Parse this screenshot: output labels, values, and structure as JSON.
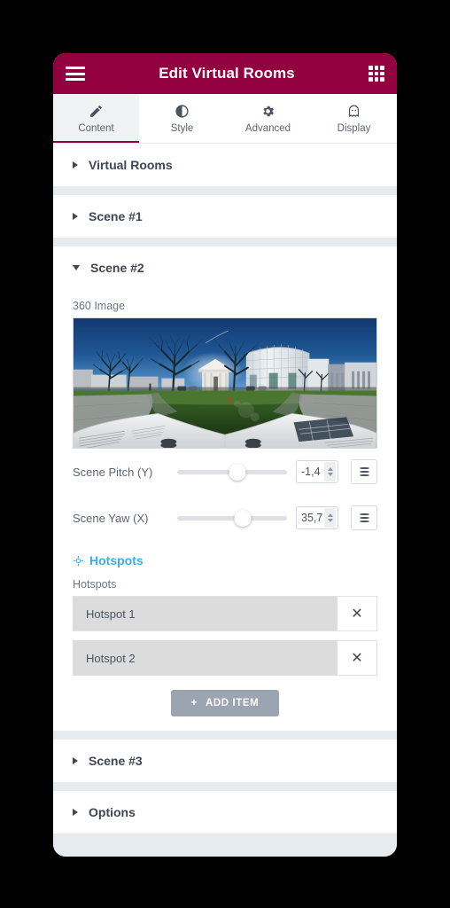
{
  "topbar": {
    "menu_icon": "hamburger-menu-icon",
    "title": "Edit Virtual Rooms",
    "apps_icon": "grid-apps-icon"
  },
  "tabs": [
    {
      "label": "Content",
      "icon": "pencil-icon",
      "active": true
    },
    {
      "label": "Style",
      "icon": "contrast-icon",
      "active": false
    },
    {
      "label": "Advanced",
      "icon": "gear-icon",
      "active": false
    },
    {
      "label": "Display",
      "icon": "ghost-icon",
      "active": false
    }
  ],
  "sections": {
    "virtual_rooms": "Virtual Rooms",
    "scene_1": "Scene #1",
    "scene_2": "Scene #2",
    "scene_3": "Scene #3",
    "options": "Options"
  },
  "scene2": {
    "image_label": "360 Image",
    "sliders": [
      {
        "name": "Scene Pitch (Y)",
        "value": "-1,4",
        "percent": 55
      },
      {
        "name": "Scene Yaw (X)",
        "value": "35,7",
        "percent": 60
      }
    ],
    "hotspots_heading": "Hotspots",
    "hotspots_field_label": "Hotspots",
    "hotspots": [
      {
        "label": "Hotspot 1",
        "delete_icon": "close-icon"
      },
      {
        "label": "Hotspot 2",
        "delete_icon": "close-icon"
      }
    ],
    "add_item_label": "ADD ITEM",
    "add_item_icon": "plus-icon"
  },
  "colors": {
    "brand_maroon": "#93003f",
    "accent_blue": "#3dade4",
    "panel_bg": "#e6ebef",
    "button_gray": "#9aa5b1"
  }
}
